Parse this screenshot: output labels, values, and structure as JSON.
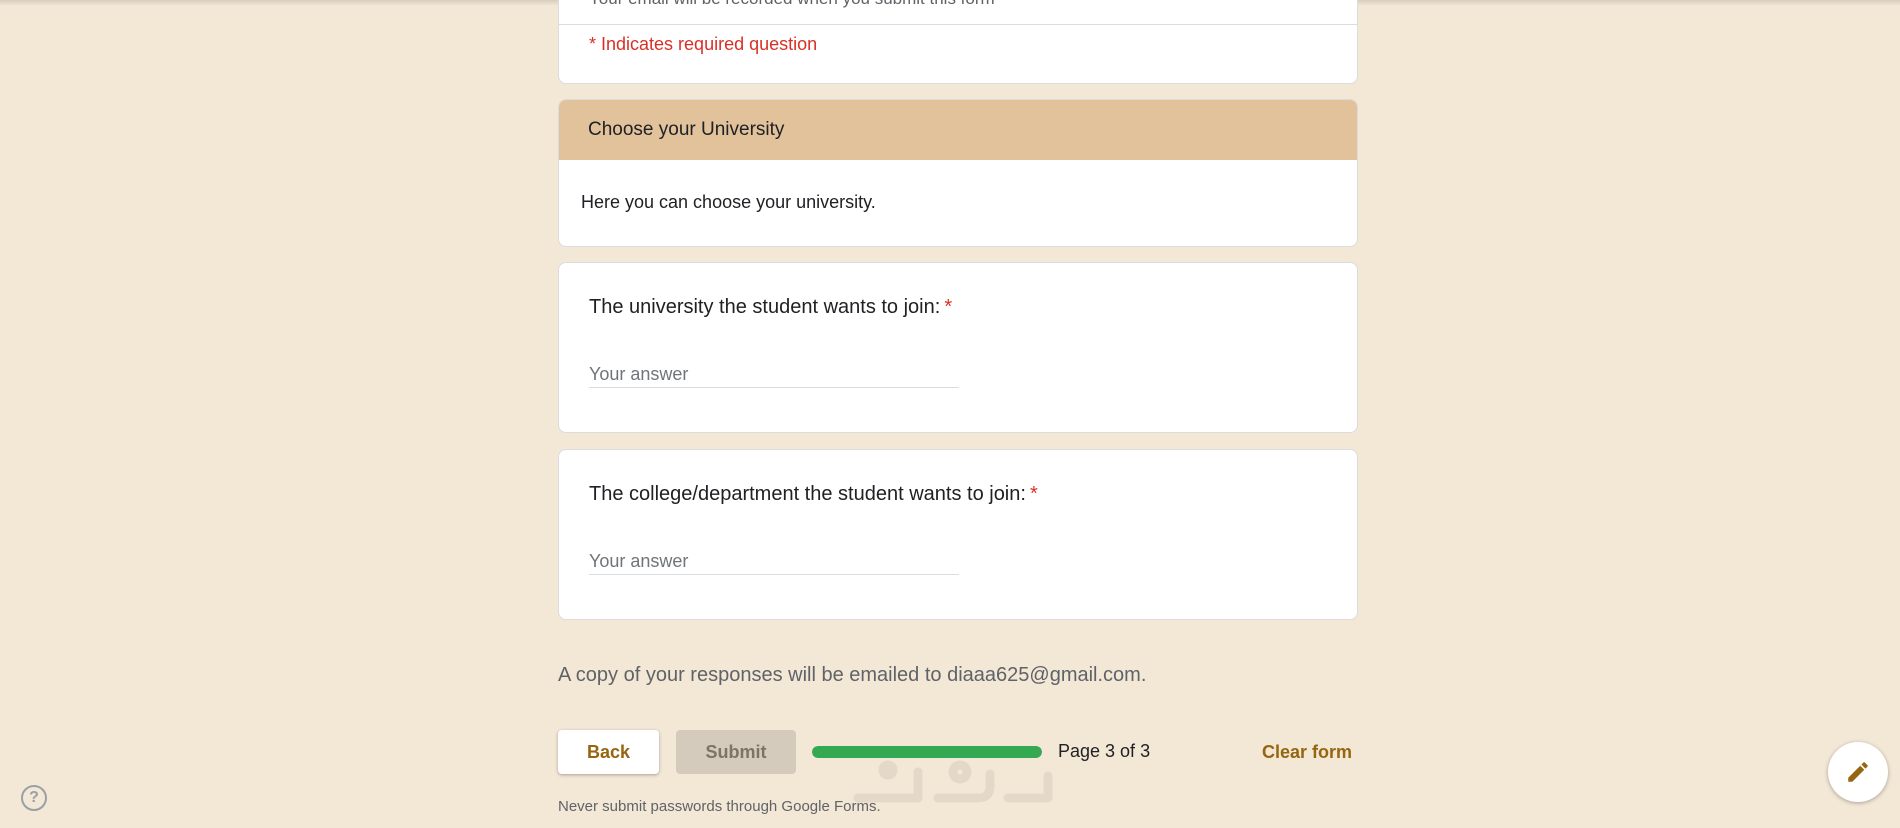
{
  "header_card": {
    "cut_text": "Your email will be recorded when you submit this form",
    "required_note": "* Indicates required question"
  },
  "section": {
    "title": "Choose your University",
    "description": "Here you can choose your university."
  },
  "questions": [
    {
      "title": "The university the student wants to join:",
      "required_mark": "*",
      "placeholder": "Your answer"
    },
    {
      "title": "The college/department the student wants to join:",
      "required_mark": "*",
      "placeholder": "Your answer"
    }
  ],
  "copy_notice": "A copy of your responses will be emailed to diaaa625@gmail.com.",
  "footer": {
    "back_label": "Back",
    "submit_label": "Submit",
    "progress_fraction": 1.0,
    "page_text": "Page 3 of 3",
    "clear_label": "Clear form",
    "password_warning": "Never submit passwords through Google Forms."
  },
  "help_icon": "?",
  "icons": {
    "help": "help-circle-icon",
    "edit": "pencil-icon"
  },
  "colors": {
    "background": "#f3e7d6",
    "section_header": "#e2c29a",
    "accent": "#96650f",
    "progress": "#34a853",
    "required": "#d93025"
  }
}
